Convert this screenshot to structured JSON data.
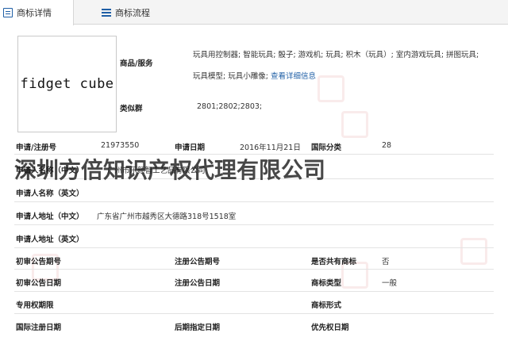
{
  "tabs": [
    {
      "label": "商标详情",
      "active": true,
      "icon": "document-icon"
    },
    {
      "label": "商标流程",
      "active": false,
      "icon": "list-icon"
    }
  ],
  "logo_text": "fidget cube",
  "goods": {
    "label": "商品/服务",
    "line1": "玩具用控制器; 智能玩具; 骰子; 游戏机; 玩具; 积木（玩具）; 室内游戏玩具; 拼图玩具;",
    "line2": "玩具模型; 玩具小雕像; ",
    "more_link": "查看详细信息"
  },
  "similar_group": {
    "label": "类似群",
    "value": "2801;2802;2803;"
  },
  "fields": {
    "app_no_label": "申请/注册号",
    "app_no": "21973550",
    "app_date_label": "申请日期",
    "app_date": "2016年11月21日",
    "intl_class_label": "国际分类",
    "intl_class": "28",
    "applicant_cn_label": "申请人名称（中文）",
    "applicant_cn": "广州市乐颜智工艺品有限公司",
    "applicant_en_label": "申请人名称（英文）",
    "applicant_en": "",
    "address_cn_label": "申请人地址（中文）",
    "address_cn": "广东省广州市越秀区大德路318号1518室",
    "address_en_label": "申请人地址（英文）",
    "address_en": "",
    "prelim_no_label": "初审公告期号",
    "prelim_no": "",
    "reg_no_label": "注册公告期号",
    "reg_no": "",
    "shared_label": "是否共有商标",
    "shared": "否",
    "prelim_date_label": "初审公告日期",
    "prelim_date": "",
    "reg_date_label": "注册公告日期",
    "reg_date": "",
    "type_label": "商标类型",
    "type": "一般",
    "exclusive_label": "专用权期限",
    "exclusive": "",
    "form_label": "商标形式",
    "form": "",
    "intl_reg_label": "国际注册日期",
    "intl_reg": "",
    "later_date_label": "后期指定日期",
    "later_date": "",
    "priority_label": "优先权日期",
    "priority": ""
  },
  "watermark": "深圳方倍知识产权代理有限公司"
}
